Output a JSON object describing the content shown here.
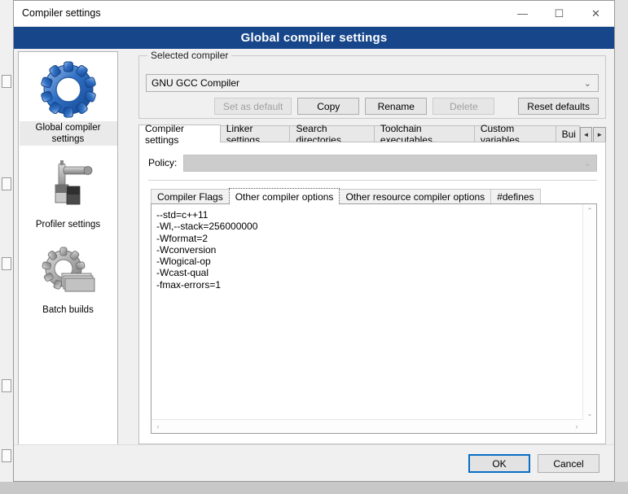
{
  "window": {
    "title": "Compiler settings",
    "banner_title": "Global compiler settings",
    "minimize_icon": "—",
    "maximize_icon": "☐",
    "close_icon": "✕"
  },
  "sidebar": {
    "items": [
      {
        "label": "Global compiler settings",
        "icon": "gear-blue-icon",
        "selected": true
      },
      {
        "label": "Profiler settings",
        "icon": "robot-arm-icon",
        "selected": false
      },
      {
        "label": "Batch builds",
        "icon": "gear-stack-icon",
        "selected": false
      }
    ]
  },
  "selected_compiler": {
    "legend": "Selected compiler",
    "value": "GNU GCC Compiler",
    "chevron": "⌄",
    "buttons": [
      {
        "label": "Set as default",
        "disabled": true
      },
      {
        "label": "Copy",
        "disabled": false
      },
      {
        "label": "Rename",
        "disabled": false
      },
      {
        "label": "Delete",
        "disabled": true
      },
      {
        "label": "Reset defaults",
        "disabled": false
      }
    ]
  },
  "tabs": {
    "items": [
      {
        "label": "Compiler settings",
        "active": true
      },
      {
        "label": "Linker settings",
        "active": false
      },
      {
        "label": "Search directories",
        "active": false
      },
      {
        "label": "Toolchain executables",
        "active": false
      },
      {
        "label": "Custom variables",
        "active": false
      },
      {
        "label": "Bui",
        "active": false,
        "truncated": true
      }
    ],
    "nav_left": "◄",
    "nav_right": "►"
  },
  "policy": {
    "label": "Policy:",
    "value": "",
    "chevron": "⌄",
    "disabled": true
  },
  "inner_tabs": {
    "items": [
      {
        "label": "Compiler Flags",
        "active": false
      },
      {
        "label": "Other compiler options",
        "active": true
      },
      {
        "label": "Other resource compiler options",
        "active": false
      },
      {
        "label": "#defines",
        "active": false
      }
    ]
  },
  "editor": {
    "text": "--std=c++11\n-Wl,--stack=256000000\n-Wformat=2\n-Wconversion\n-Wlogical-op\n-Wcast-qual\n-fmax-errors=1",
    "scroll_up_icon": "⌃",
    "scroll_down_icon": "⌄",
    "scroll_left_icon": "‹",
    "scroll_right_icon": "›"
  },
  "footer": {
    "ok_label": "OK",
    "cancel_label": "Cancel"
  },
  "colors": {
    "banner": "#17468a",
    "focus_border": "#0a6ec4",
    "dialog_bg": "#f0f0f0"
  }
}
